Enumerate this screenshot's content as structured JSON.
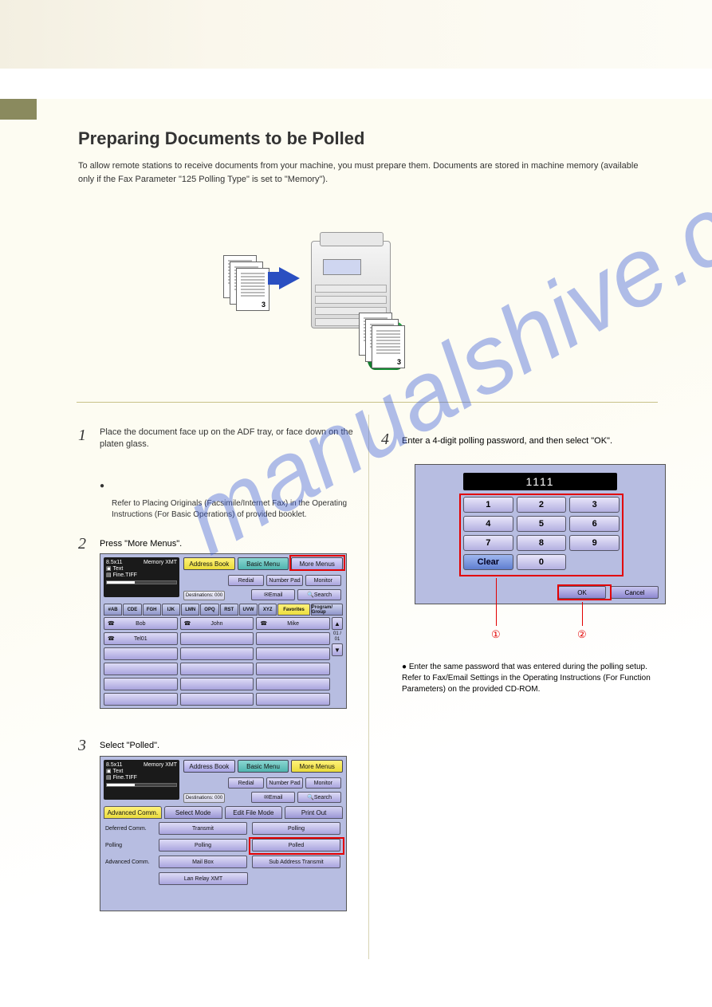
{
  "section_title": "Preparing Documents to be Polled",
  "lead": "To allow remote stations to receive documents from your machine, you must prepare them. Documents are stored in machine memory (available only if the Fax Parameter \"125 Polling Type\" is set to \"Memory\").",
  "step1": {
    "lead": "Place the document face up on the ADF tray, or face down on the platen glass.",
    "sub1": "Refer to Placing Originals (Facsimile/Internet Fax) in the Operating Instructions (For Basic Operations) of provided booklet."
  },
  "step2_text": "Press \"More Menus\".",
  "step3_text": "Select \"Polled\".",
  "step4_lead": "Enter a 4-digit polling password, and then select \"OK\".",
  "qnote": "Enter the same password that was entered during the polling setup. Refer to Fax/Email Settings in the Operating Instructions (For Function Parameters) on the provided CD-ROM.",
  "fax_screen": {
    "status": {
      "size": "8.5x11",
      "mode": "Memory XMT",
      "orig": "Text",
      "res": "Fine.TIFF"
    },
    "dest": "Destinations: 000",
    "tabs": {
      "ab": "Address Book",
      "basic": "Basic Menu",
      "more": "More Menus"
    },
    "row2": {
      "redial": "Redial",
      "numpad": "Number Pad",
      "monitor": "Monitor"
    },
    "row3": {
      "email": "Email",
      "search": "Search"
    },
    "alpha": [
      "#AB",
      "CDE",
      "FGH",
      "IJK",
      "LMN",
      "OPQ",
      "RST",
      "UVW",
      "XYZ",
      "Favorites",
      "Program/ Group"
    ],
    "contacts": [
      "Bob",
      "John",
      "Mike",
      "Tel01"
    ],
    "scroll_ind": "01 / 01"
  },
  "more_menus": {
    "tabs": {
      "adv": "Advanced Comm.",
      "sel": "Select Mode",
      "edit": "Edit File Mode",
      "print": "Print Out"
    },
    "rows": [
      {
        "label": "Deferred Comm.",
        "b1": "Transmit",
        "b2": "Polling"
      },
      {
        "label": "Polling",
        "b1": "Polling",
        "b2": "Polled"
      },
      {
        "label": "Advanced Comm.",
        "b1": "Mail Box",
        "b2": "Sub Address Transmit"
      },
      {
        "label": "",
        "b1": "Lan Relay XMT",
        "b2": ""
      }
    ]
  },
  "numpad": {
    "display": "1111",
    "keys": [
      "1",
      "2",
      "3",
      "4",
      "5",
      "6",
      "7",
      "8",
      "9",
      "Clear",
      "0",
      ""
    ],
    "ok": "OK",
    "cancel": "Cancel"
  },
  "callouts": {
    "c1": "①",
    "c2": "②"
  }
}
